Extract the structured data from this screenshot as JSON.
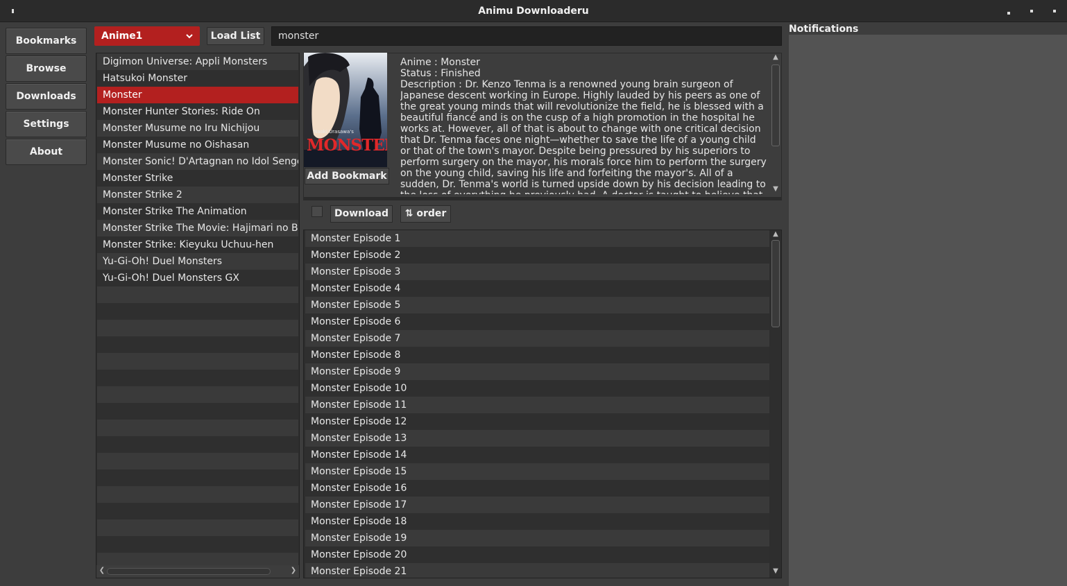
{
  "window": {
    "title": "Animu Downloaderu"
  },
  "sidebar": {
    "items": [
      {
        "label": "Bookmarks"
      },
      {
        "label": "Browse"
      },
      {
        "label": "Downloads"
      },
      {
        "label": "Settings"
      },
      {
        "label": "About"
      }
    ]
  },
  "toolbar": {
    "source_selected": "Anime1",
    "load_list_label": "Load List",
    "search_value": "monster"
  },
  "results": {
    "items": [
      "Digimon Universe: Appli Monsters",
      "Hatsukoi Monster",
      "Monster",
      "Monster Hunter Stories: Ride On",
      "Monster Musume no Iru Nichijou",
      "Monster Musume no Oishasan",
      "Monster Sonic! D'Artagnan no Idol Sengen",
      "Monster Strike",
      "Monster Strike 2",
      "Monster Strike The Animation",
      "Monster Strike The Movie: Hajimari no Basho e",
      "Monster Strike: Kieyuku Uchuu-hen",
      "Yu-Gi-Oh! Duel Monsters",
      "Yu-Gi-Oh! Duel Monsters GX"
    ],
    "selected_index": 2
  },
  "detail": {
    "anime_line": "Anime : Monster",
    "status_line": "Status : Finished",
    "description": "Description : Dr. Kenzo Tenma is a renowned young brain surgeon of Japanese descent working in Europe. Highly lauded by his peers as one of the great young minds that will revolutionize the field, he is blessed with a beautiful fiancé and is on the cusp of a high promotion in the hospital he works at. However, all of that is about to change with one critical decision that Dr. Tenma faces one night—whether to save the life of a young child or that of the town's mayor. Despite being pressured by his superiors to perform surgery on the mayor, his morals force him to perform the surgery on the young child, saving his life and forfeiting the mayor's. All of a sudden, Dr. Tenma's world is turned upside down by his decision leading to the loss of everything he previously had. A doctor is taught to believe that all life is equal; however, when a series of",
    "cover_small_text": "Naoki Urasawa's",
    "cover_title": "MONSTER",
    "add_bookmark_label": "Add Bookmark"
  },
  "episodes": {
    "download_label": "Download",
    "order_label": "⇅ order",
    "items": [
      "Monster Episode 1",
      "Monster Episode 2",
      "Monster Episode 3",
      "Monster Episode 4",
      "Monster Episode 5",
      "Monster Episode 6",
      "Monster Episode 7",
      "Monster Episode 8",
      "Monster Episode 9",
      "Monster Episode 10",
      "Monster Episode 11",
      "Monster Episode 12",
      "Monster Episode 13",
      "Monster Episode 14",
      "Monster Episode 15",
      "Monster Episode 16",
      "Monster Episode 17",
      "Monster Episode 18",
      "Monster Episode 19",
      "Monster Episode 20",
      "Monster Episode 21"
    ]
  },
  "notifications": {
    "title": "Notifications"
  },
  "colors": {
    "accent": "#b3201f",
    "background": "#3d3d3d",
    "list_bg": "#2e2e2e",
    "notifications_bg": "#535353"
  }
}
